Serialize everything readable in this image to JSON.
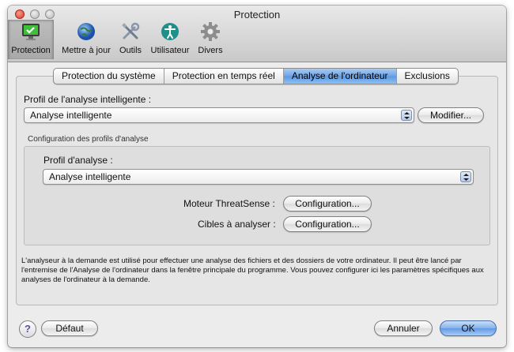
{
  "window": {
    "title": "Protection"
  },
  "toolbar": {
    "items": [
      {
        "label": "Protection",
        "icon": "monitor-check-icon",
        "selected": true
      },
      {
        "label": "Mettre à jour",
        "icon": "globe-icon"
      },
      {
        "label": "Outils",
        "icon": "tools-icon"
      },
      {
        "label": "Utilisateur",
        "icon": "user-accessibility-icon"
      },
      {
        "label": "Divers",
        "icon": "gear-icon"
      }
    ]
  },
  "tabs": [
    {
      "label": "Protection du système"
    },
    {
      "label": "Protection en temps réel"
    },
    {
      "label": "Analyse de l'ordinateur",
      "active": true
    },
    {
      "label": "Exclusions"
    }
  ],
  "smart_scan": {
    "label": "Profil de l'analyse intelligente :",
    "value": "Analyse intelligente",
    "modify_label": "Modifier..."
  },
  "profiles_config": {
    "title": "Configuration des profils d'analyse",
    "profile_label": "Profil d'analyse :",
    "profile_value": "Analyse intelligente",
    "engine_label": "Moteur ThreatSense :",
    "engine_button": "Configuration...",
    "targets_label": "Cibles à analyser :",
    "targets_button": "Configuration..."
  },
  "description": "L'analyseur à la demande est utilisé pour effectuer une analyse des fichiers et des dossiers de votre ordinateur. Il peut être lancé par l'entremise de l'Analyse de l'ordinateur dans la fenêtre principale du programme. Vous pouvez configurer ici les paramètres spécifiques aux analyses de l'ordinateur à la demande.",
  "footer": {
    "help_label": "?",
    "default_label": "Défaut",
    "cancel_label": "Annuler",
    "ok_label": "OK"
  },
  "colors": {
    "accent": "#6399e4",
    "help": "#5a4fa3"
  }
}
